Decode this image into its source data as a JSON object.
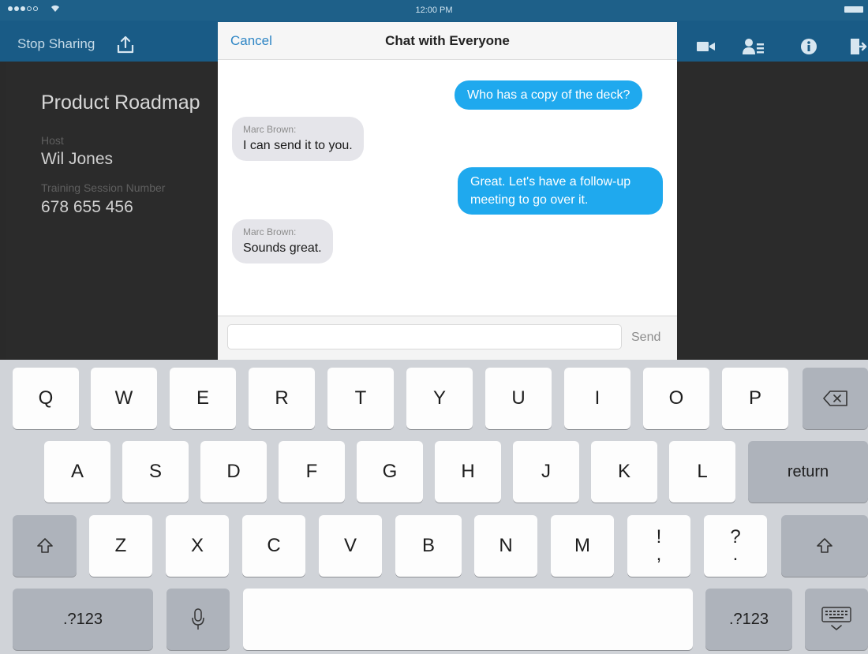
{
  "status_bar": {
    "time": "12:00 PM",
    "signal_dots": 5,
    "signal_level": 3
  },
  "toolbar": {
    "stop_sharing": "Stop Sharing",
    "icons": [
      "share-icon",
      "video-camera-icon",
      "participants-icon",
      "info-icon",
      "leave-icon"
    ]
  },
  "session": {
    "title": "Product Roadmap",
    "host_label": "Host",
    "host_name": "Wil Jones",
    "session_number_label": "Training Session Number",
    "session_number": "678 655 456"
  },
  "chat": {
    "cancel": "Cancel",
    "title": "Chat with Everyone",
    "messages": [
      {
        "direction": "outgoing",
        "text": "Who has a copy of the deck?"
      },
      {
        "direction": "incoming",
        "sender": "Marc Brown:",
        "text": "I can send it to you."
      },
      {
        "direction": "outgoing",
        "text": "Great. Let's have a follow-up meeting to go over it."
      },
      {
        "direction": "incoming",
        "sender": "Marc Brown:",
        "text": "Sounds great."
      }
    ],
    "input_value": "",
    "send": "Send"
  },
  "keyboard": {
    "row1": [
      "Q",
      "W",
      "E",
      "R",
      "T",
      "Y",
      "U",
      "I",
      "O",
      "P"
    ],
    "row2": [
      "A",
      "S",
      "D",
      "F",
      "G",
      "H",
      "J",
      "K",
      "L"
    ],
    "row3": [
      "Z",
      "X",
      "C",
      "V",
      "B",
      "N",
      "M"
    ],
    "punct1_top": "!",
    "punct1_bottom": ",",
    "punct2_top": "?",
    "punct2_bottom": ".",
    "return": "return",
    "numbers_left": ".?123",
    "numbers_right": ".?123"
  },
  "colors": {
    "toolbar": "#195b86",
    "bubble_outgoing": "#1fa9ee",
    "bubble_incoming": "#e5e5ea",
    "link": "#2f86c5"
  }
}
